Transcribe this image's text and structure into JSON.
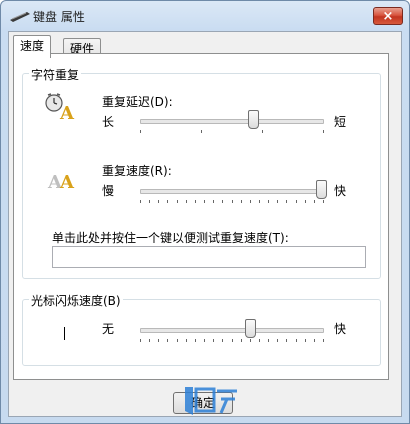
{
  "window": {
    "title": "键盘 属性",
    "close_label": "×"
  },
  "tabs": [
    {
      "label": "速度",
      "active": true
    },
    {
      "label": "硬件",
      "active": false
    }
  ],
  "char_repeat": {
    "group_title": "字符重复",
    "delay": {
      "label": "重复延迟(D):",
      "min_label": "长",
      "max_label": "短",
      "level": 0.62,
      "ticks": 4
    },
    "rate": {
      "label": "重复速度(R):",
      "min_label": "慢",
      "max_label": "快",
      "level": 1.0,
      "ticks": 21
    },
    "test": {
      "label": "单击此处并按住一个键以便测试重复速度(T):",
      "value": ""
    }
  },
  "cursor_blink": {
    "group_title": "光标闪烁速度(B)",
    "min_label": "无",
    "max_label": "快",
    "level": 0.6,
    "ticks": 21
  },
  "buttons": {
    "ok_label": "确定"
  },
  "colors": {
    "accent": "#2b7fd6",
    "close": "#c9402b"
  }
}
